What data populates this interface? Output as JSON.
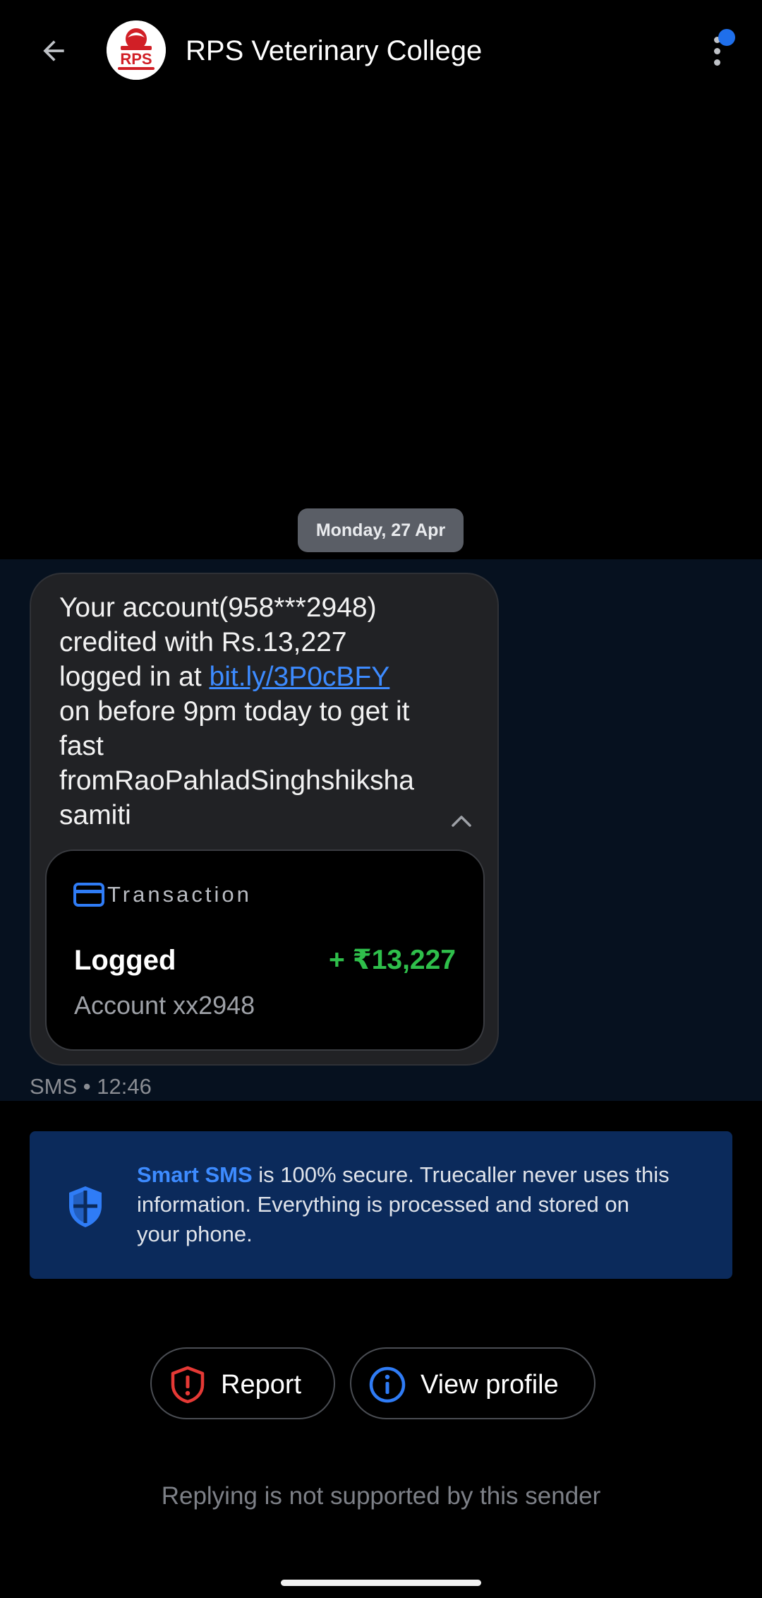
{
  "header": {
    "title": "RPS Veterinary College",
    "avatar_text": "RPS",
    "back_icon": "arrow-left-icon",
    "menu_icon": "more-vertical-icon"
  },
  "conversation": {
    "date_chip": "Monday, 27 Apr",
    "message": {
      "line1": "Your account(958***2948)",
      "line2": "credited with Rs.13,227",
      "line3_prefix": "logged in at ",
      "link": "bit.ly/3P0cBFY",
      "line4": "on before 9pm today to get it",
      "line5": "fast",
      "line6": "fromRaoPahladSinghshiksha",
      "line7": "samiti"
    },
    "transaction_card": {
      "label": "Transaction",
      "status": "Logged",
      "amount": "+ ₹13,227",
      "account": "Account xx2948"
    },
    "meta": "SMS • 12:46"
  },
  "info_banner": {
    "brand": "Smart SMS",
    "line1_rest": " is 100% secure. Truecaller never uses this",
    "line2": "information. Everything is processed and stored on",
    "line3": "your phone."
  },
  "actions": {
    "report_label": "Report",
    "view_profile_label": "View profile"
  },
  "footer": {
    "note": "Replying is not supported by this sender"
  },
  "colors": {
    "accent": "#3d8bff",
    "positive": "#2fbf4b",
    "danger": "#e53935",
    "banner": "#0b2a5b"
  }
}
